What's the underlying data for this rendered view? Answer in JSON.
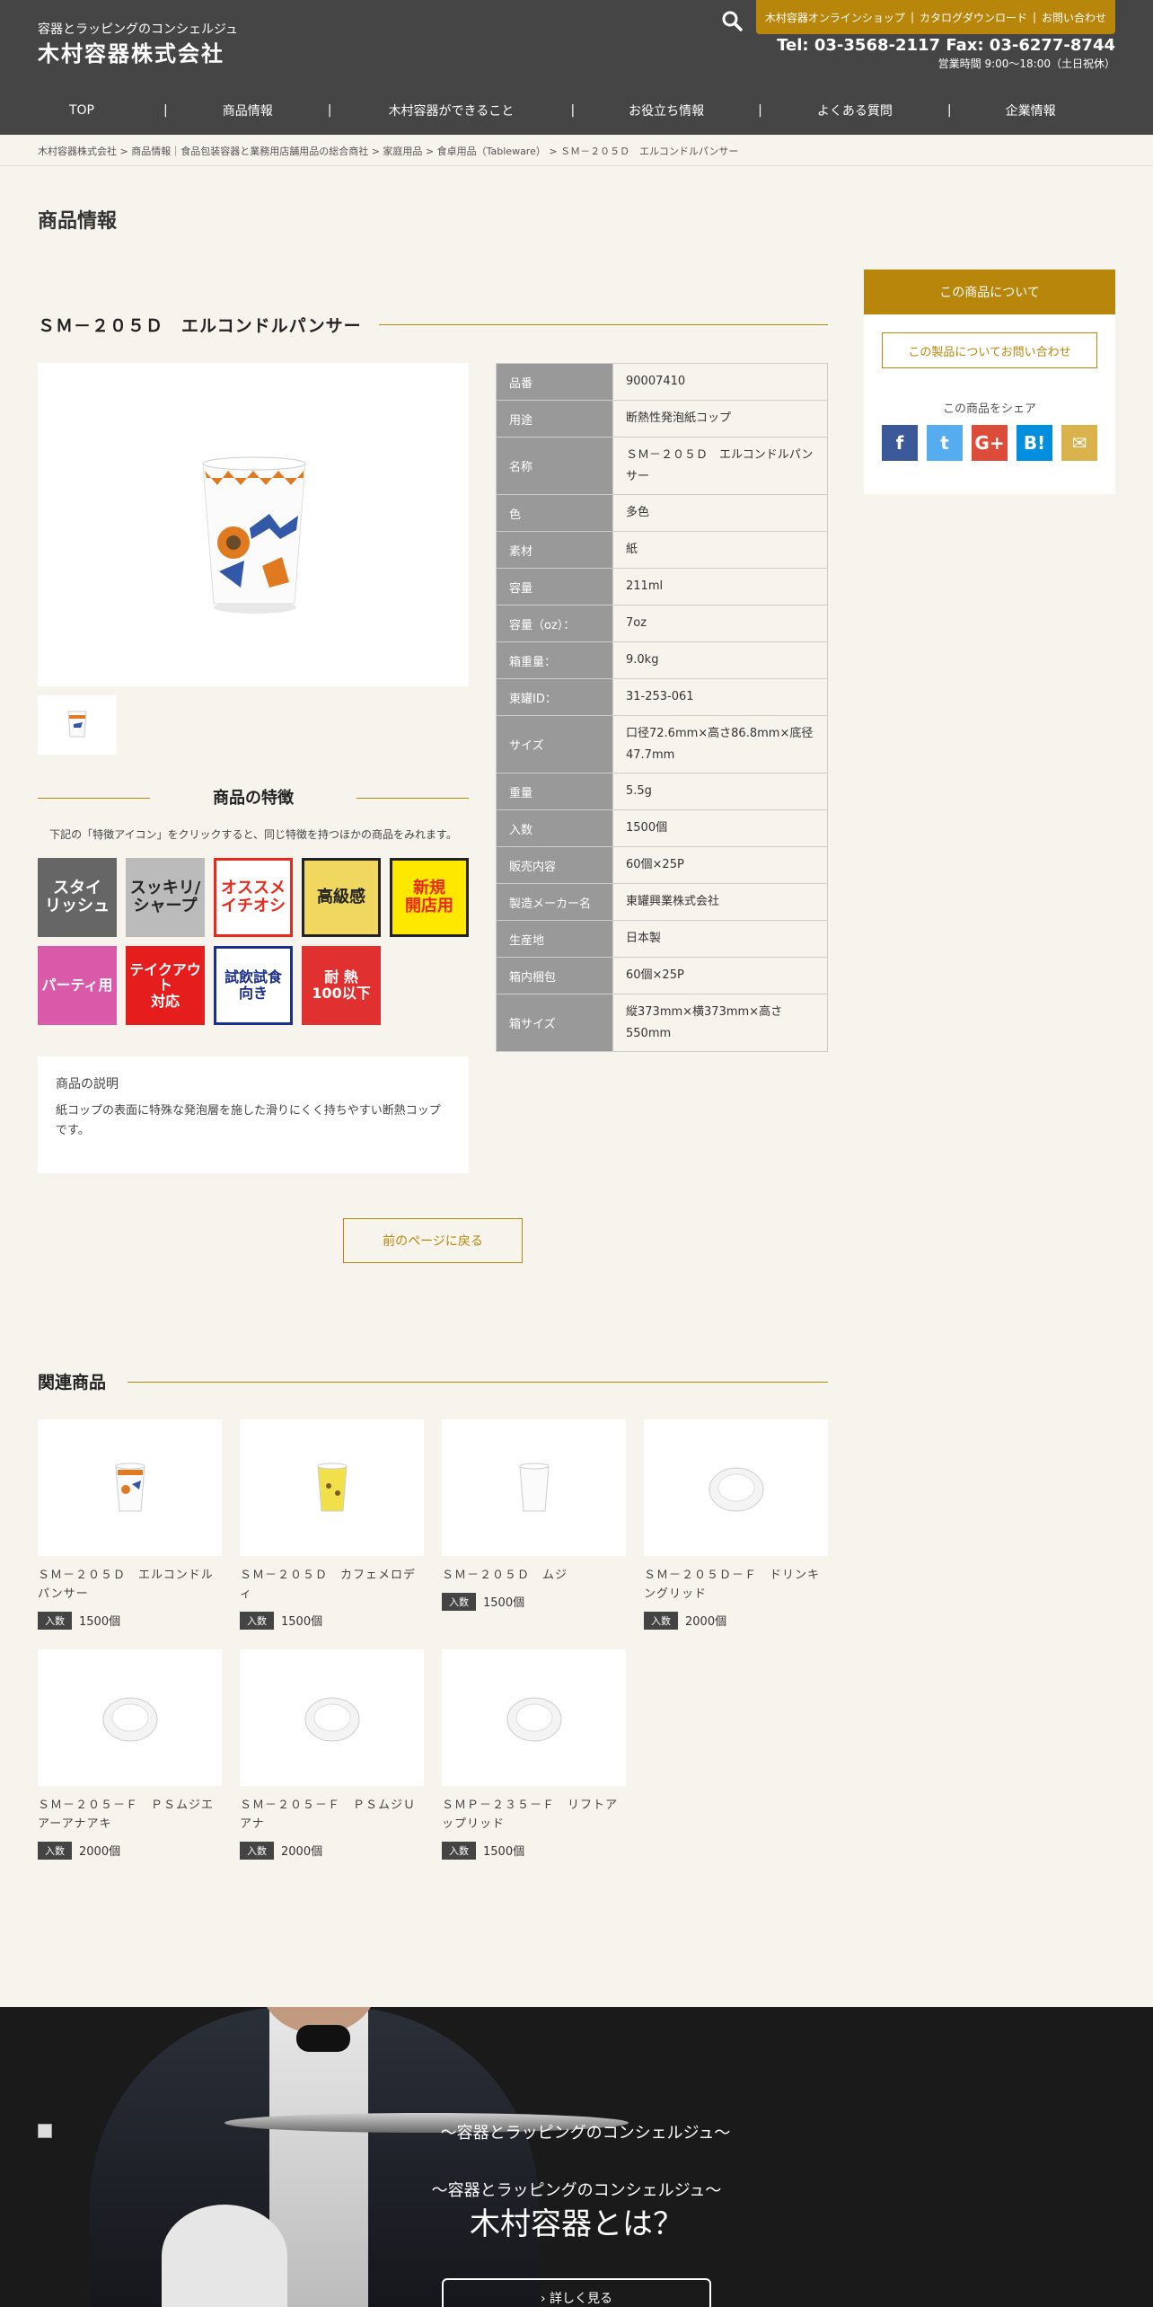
{
  "header": {
    "logo_sub": "容器とラッピングのコンシェルジュ",
    "logo_main": "木村容器株式会社",
    "top_links": [
      "木村容器オンラインショップ",
      "カタログダウンロード",
      "お問い合わせ"
    ],
    "tel": "Tel: 03-3568-2117 Fax: 03-6277-8744",
    "hours": "営業時間 9:00〜18:00（土日祝休）",
    "accent": "#b8860b"
  },
  "nav": [
    "TOP",
    "商品情報",
    "木村容器ができること",
    "お役立ち情報",
    "よくある質問",
    "企業情報"
  ],
  "breadcrumb": "木村容器株式会社 > 商品情報｜食品包装容器と業務用店舗用品の総合商社 > 家庭用品 > 食卓用品（Tableware） > ＳＭ－２０５Ｄ　エルコンドルパンサー",
  "page_title": "商品情報",
  "product": {
    "title": "ＳＭ－２０５Ｄ　エルコンドルパンサー",
    "features_title": "商品の特徴",
    "features_note": "下記の「特徴アイコン」をクリックすると、同じ特徴を持つほかの商品をみれます。",
    "feature_icons": [
      {
        "label": "スタイ\nリッシュ",
        "name": "stylish-icon",
        "bg": "#666666",
        "fg": "#ffffff"
      },
      {
        "label": "スッキリ/\nシャープ",
        "name": "sharp-icon",
        "bg": "#bbbbbb",
        "fg": "#222222"
      },
      {
        "label": "オススメ\nイチオシ",
        "name": "recommend-icon",
        "bg": "#ffffff",
        "fg": "#e8291c"
      },
      {
        "label": "高級感",
        "name": "luxury-icon",
        "bg": "#f0d860",
        "fg": "#222222"
      },
      {
        "label": "新規\n開店用",
        "name": "new-store-icon",
        "bg": "#ffe800",
        "fg": "#e8291c"
      },
      {
        "label": "パーティ用",
        "name": "party-icon",
        "bg": "#d85aa8",
        "fg": "#ffffff"
      },
      {
        "label": "テイクアウト\n対応",
        "name": "takeout-icon",
        "bg": "#e51d1d",
        "fg": "#ffffff"
      },
      {
        "label": "試飲試食\n向き",
        "name": "tasting-icon",
        "bg": "#ffffff",
        "fg": "#1c2f8a"
      },
      {
        "label": "耐 熱\n100以下",
        "name": "heat-resistant-icon",
        "bg": "#e03030",
        "fg": "#ffffff"
      }
    ],
    "description_heading": "商品の説明",
    "description": "紙コップの表面に特殊な発泡層を施した滑りにくく持ちやすい断熱コップです。",
    "back_button": "前のページに戻る",
    "specs": [
      {
        "k": "品番",
        "v": "90007410"
      },
      {
        "k": "用途",
        "v": "断熱性発泡紙コップ"
      },
      {
        "k": "名称",
        "v": "ＳＭ－２０５Ｄ　エルコンドルパンサー"
      },
      {
        "k": "色",
        "v": "多色"
      },
      {
        "k": "素材",
        "v": "紙"
      },
      {
        "k": "容量",
        "v": "211ml"
      },
      {
        "k": "容量（oz）：",
        "v": "7oz"
      },
      {
        "k": "箱重量：",
        "v": "9.0kg"
      },
      {
        "k": "東罐ID：",
        "v": "31-253-061"
      },
      {
        "k": "サイズ",
        "v": "口径72.6mm×高さ86.8mm×底径47.7mm"
      },
      {
        "k": "重量",
        "v": "5.5g"
      },
      {
        "k": "入数",
        "v": "1500個"
      },
      {
        "k": "販売内容",
        "v": "60個×25P"
      },
      {
        "k": "製造メーカー名",
        "v": "東罐興業株式会社"
      },
      {
        "k": "生産地",
        "v": "日本製"
      },
      {
        "k": "箱内梱包",
        "v": "60個×25P"
      },
      {
        "k": "箱サイズ",
        "v": "縦373mm×横373mm×高さ550mm"
      }
    ]
  },
  "sidebar": {
    "head": "この商品について",
    "contact_button": "この製品についてお問い合わせ",
    "share_label": "この商品をシェア",
    "share_icons": [
      {
        "name": "facebook-icon",
        "glyph": "f",
        "color": "#3b5998"
      },
      {
        "name": "twitter-icon",
        "glyph": "t",
        "color": "#55acee"
      },
      {
        "name": "google-plus-icon",
        "glyph": "G+",
        "color": "#dd4b39"
      },
      {
        "name": "hatena-bookmark-icon",
        "glyph": "B!",
        "color": "#008fde"
      },
      {
        "name": "mail-icon",
        "glyph": "✉",
        "color": "#d9b24c"
      }
    ]
  },
  "related": {
    "title": "関連商品",
    "qty_tag": "入数",
    "items": [
      {
        "name": "ＳＭ－２０５Ｄ　エルコンドルパンサー",
        "qty": "1500個",
        "cup": "condor"
      },
      {
        "name": "ＳＭ－２０５Ｄ　カフェメロディ",
        "qty": "1500個",
        "cup": "yellow"
      },
      {
        "name": "ＳＭ－２０５Ｄ　ムジ",
        "qty": "1500個",
        "cup": "plain"
      },
      {
        "name": "ＳＭ－２０５Ｄ－Ｆ　ドリンキングリッド",
        "qty": "2000個",
        "cup": "lid"
      },
      {
        "name": "ＳＭ－２０５－Ｆ　ＰＳムジエアーアナアキ",
        "qty": "2000個",
        "cup": "lid"
      },
      {
        "name": "ＳＭ－２０５－Ｆ　ＰＳムジＵアナ",
        "qty": "2000個",
        "cup": "lid"
      },
      {
        "name": "ＳＭＰ－２３５－Ｆ　リフトアップリッド",
        "qty": "1500個",
        "cup": "lid2"
      }
    ]
  },
  "footer": {
    "alt_text": "〜容器とラッピングのコンシェルジュ〜",
    "sub": "〜容器とラッピングのコンシェルジュ〜",
    "big": "木村容器とは？",
    "more": "› 詳しく見る"
  }
}
